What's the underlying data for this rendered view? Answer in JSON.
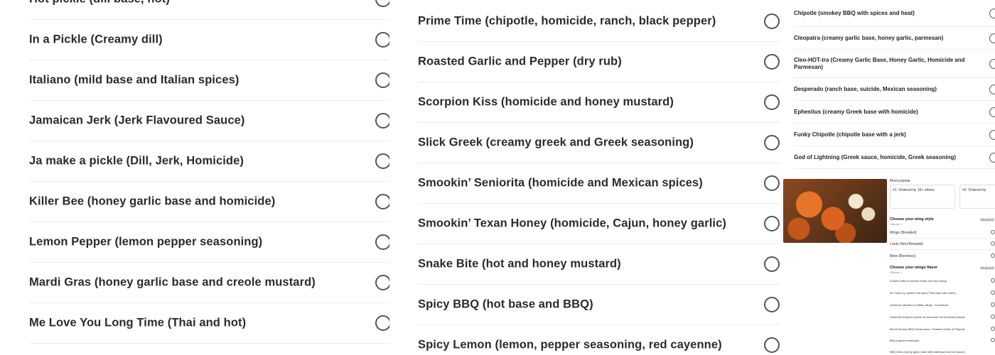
{
  "left_list": {
    "items": [
      {
        "label": "Hot pickle (dill base, hot)"
      },
      {
        "label": "In a Pickle (Creamy dill)"
      },
      {
        "label": "Italiano (mild base and Italian spices)"
      },
      {
        "label": "Jamaican Jerk (Jerk Flavoured Sauce)"
      },
      {
        "label": "Ja make a pickle (Dill, Jerk, Homicide)"
      },
      {
        "label": "Killer Bee (honey garlic base and homicide)"
      },
      {
        "label": "Lemon Pepper (lemon pepper seasoning)"
      },
      {
        "label": "Mardi Gras (honey garlic base and creole mustard)"
      },
      {
        "label": "Me Love You Long Time (Thai and hot)"
      }
    ]
  },
  "mid_list": {
    "items": [
      {
        "label": "Prime Time (chipotle, homicide, ranch, black pepper)"
      },
      {
        "label": "Roasted Garlic and Pepper (dry rub)"
      },
      {
        "label": "Scorpion Kiss (homicide and honey mustard)"
      },
      {
        "label": "Slick Greek (creamy greek and Greek seasoning)"
      },
      {
        "label": "Smookin’ Seniorita (homicide and Mexican spices)"
      },
      {
        "label": "Smookin’ Texan Honey (homicide, Cajun, honey garlic)"
      },
      {
        "label": "Snake Bite (hot and honey mustard)"
      },
      {
        "label": "Spicy BBQ (hot base and BBQ)"
      },
      {
        "label": "Spicy Lemon (lemon, pepper seasoning, red cayenne)"
      }
    ]
  },
  "right_list": {
    "items": [
      {
        "label": "Chipotle (smokey BBQ with spices and heat)"
      },
      {
        "label": "Cleopatra (creamy garlic base, honey garlic, parmesan)"
      },
      {
        "label": "Cleo-HOT-tra (Creamy Garlic Base, Honey Garlic, Homicide and Parmesan)"
      },
      {
        "label": "Desperado (ranch base, suicide, Mexican seasoning)"
      },
      {
        "label": "Ephestius (creamy Greek base with homicide)"
      },
      {
        "label": "Funky Chipotle (chipotle base with a jerk)"
      },
      {
        "label": "God of Lightning (Greek sauce, homicide, Greek seasoning)"
      }
    ]
  },
  "thumbnail": {
    "most_popular": "Most popular",
    "card1": "#1. Ordered by 10+ others",
    "card2": "#2. Ordered by",
    "wing_style_heading": "Choose your wing style",
    "wing_style_sub": "Choose 1",
    "required": "Required",
    "wing_styles": [
      "Wings (Breaded)",
      "Lords (Non-Breaded)",
      "Bites (Boneless)"
    ],
    "flavor_heading": "Choose your wings flavor",
    "flavor_sub": "Choose 1",
    "flavors": [
      "5 Alarm inferno (secret recipe and very spicy)",
      "All Thai'd Up (sweet and spicy Thai base with ranch)",
      "American (similar to buffalo wings - hot based)",
      "American Eruption (same as American but homicide based)",
      "Bar-B (House BBQ Greek sauce, Roasted Garlic & Pepper)",
      "Bbq (regular barbeque)",
      "BBQ bees (honey garlic base with barbeque and hot sauce)"
    ]
  }
}
